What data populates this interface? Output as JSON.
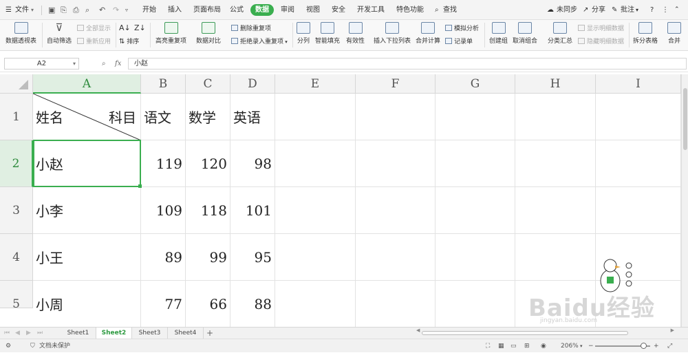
{
  "menubar": {
    "file_label": "文件",
    "tabs": [
      "开始",
      "插入",
      "页面布局",
      "公式",
      "数据",
      "审阅",
      "视图",
      "安全",
      "开发工具",
      "特色功能"
    ],
    "active_tab": "数据",
    "search_label": "查找",
    "sync_label": "未同步",
    "share_label": "分享",
    "comment_label": "批注"
  },
  "ribbon": {
    "pivot": "数据透视表",
    "autofilter": "自动筛选",
    "show_all": "全部显示",
    "reapply": "重新应用",
    "sort": "排序",
    "highlight_dup": "高亮重复项",
    "compare": "数据对比",
    "remove_dup": "删除重复项",
    "reject_dup": "拒绝录入重复项",
    "split": "分列",
    "smart_fill": "智能填充",
    "validity": "有效性",
    "dropdown": "插入下拉列表",
    "consolidate": "合并计算",
    "simulate": "模拟分析",
    "record": "记录单",
    "group": "创建组",
    "ungroup": "取消组合",
    "subtotal": "分类汇总",
    "show_detail": "显示明细数据",
    "hide_detail": "隐藏明细数据",
    "split_table": "拆分表格",
    "merge_table": "合并"
  },
  "formula_bar": {
    "cell_ref": "A2",
    "fx": "fx",
    "content": "小赵"
  },
  "columns": [
    "A",
    "B",
    "C",
    "D",
    "E",
    "F",
    "G",
    "H",
    "I"
  ],
  "rows": [
    "1",
    "2",
    "3",
    "4",
    "5"
  ],
  "sheet": {
    "header": {
      "diag_left": "姓名",
      "diag_right": "科目",
      "subjects": [
        "语文",
        "数学",
        "英语"
      ]
    },
    "data": [
      {
        "name": "小赵",
        "scores": [
          "119",
          "120",
          "98"
        ]
      },
      {
        "name": "小李",
        "scores": [
          "109",
          "118",
          "101"
        ]
      },
      {
        "name": "小王",
        "scores": [
          "89",
          "99",
          "95"
        ]
      },
      {
        "name": "小周",
        "scores": [
          "77",
          "66",
          "88"
        ]
      }
    ]
  },
  "sheet_tabs": [
    "Sheet1",
    "Sheet2",
    "Sheet3",
    "Sheet4"
  ],
  "active_sheet": "Sheet2",
  "status": {
    "protect": "文档未保护",
    "zoom": "206%"
  },
  "watermark": {
    "brand": "Baidu经验",
    "url": "jingyan.baidu.com"
  }
}
